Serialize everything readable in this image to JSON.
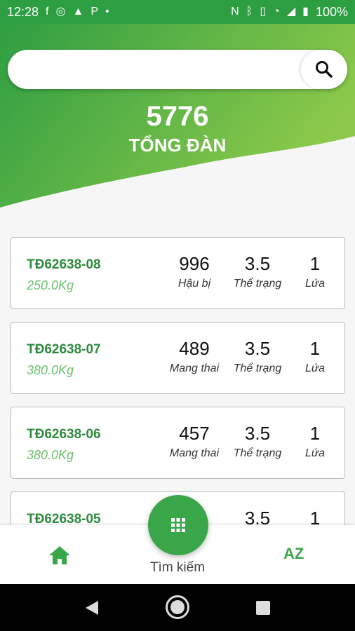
{
  "status": {
    "time": "12:28",
    "battery": "100%",
    "left_icons": [
      "facebook-icon",
      "browser-icon",
      "warning-icon",
      "p-icon",
      "dot-icon"
    ],
    "right_icons": [
      "nfc-icon",
      "bluetooth-icon",
      "vibrate-icon",
      "wifi-icon",
      "signal-icon",
      "battery-icon"
    ]
  },
  "search": {
    "placeholder": "",
    "value": ""
  },
  "summary": {
    "total": "5776",
    "label": "TỔNG ĐÀN"
  },
  "animals": [
    {
      "code": "TĐ62638-08",
      "weight": "250.0Kg",
      "stats": [
        {
          "value": "996",
          "label": "Hậu bị"
        },
        {
          "value": "3.5",
          "label": "Thể trạng"
        },
        {
          "value": "1",
          "label": "Lứa"
        }
      ]
    },
    {
      "code": "TĐ62638-07",
      "weight": "380.0Kg",
      "stats": [
        {
          "value": "489",
          "label": "Mang thai"
        },
        {
          "value": "3.5",
          "label": "Thể trạng"
        },
        {
          "value": "1",
          "label": "Lứa"
        }
      ]
    },
    {
      "code": "TĐ62638-06",
      "weight": "380.0Kg",
      "stats": [
        {
          "value": "457",
          "label": "Mang thai"
        },
        {
          "value": "3.5",
          "label": "Thể trạng"
        },
        {
          "value": "1",
          "label": "Lứa"
        }
      ]
    },
    {
      "code": "TĐ62638-05",
      "weight": "",
      "stats": [
        {
          "value": "",
          "label": ""
        },
        {
          "value": "3.5",
          "label": ""
        },
        {
          "value": "1",
          "label": ""
        }
      ]
    }
  ],
  "bottom_nav": {
    "home_icon": "home-icon",
    "fab_icon": "grid-icon",
    "fab_label": "Tìm kiếm",
    "sort_label": "AZ"
  },
  "colors": {
    "primary": "#3aa64a",
    "gradient_start": "#2e9e42",
    "gradient_end": "#8cc94a",
    "code_text": "#2e8b3e",
    "weight_text": "#6cc06c"
  }
}
